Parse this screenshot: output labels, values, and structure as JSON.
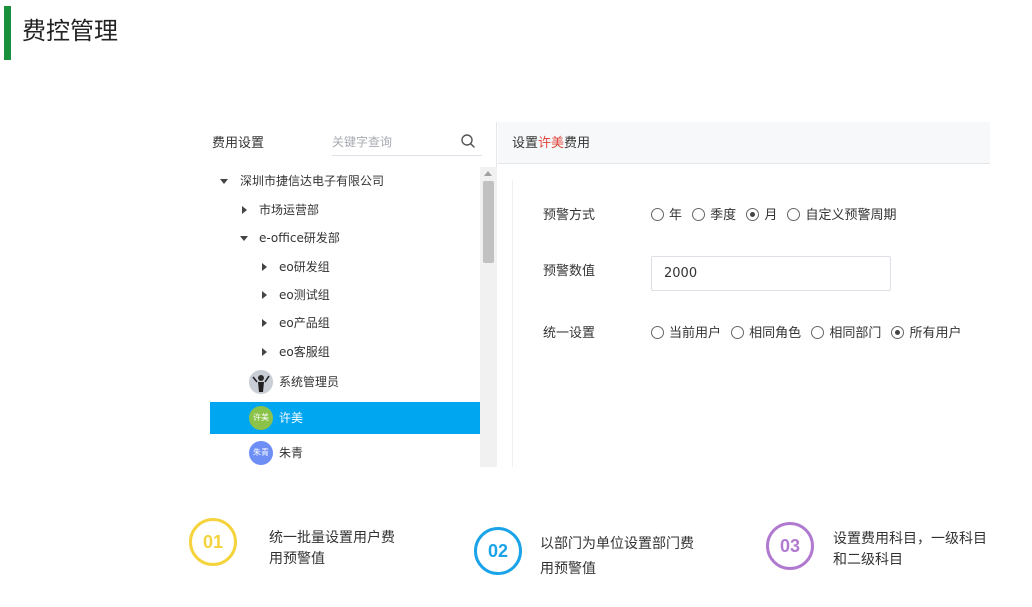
{
  "header": {
    "title": "费控管理",
    "accent_color": "#1a8f3c"
  },
  "left_panel": {
    "title": "费用设置",
    "search_placeholder": "关键字查询",
    "tree": [
      {
        "label": "深圳市捷信达电子有限公司",
        "expanded": true,
        "level": 0
      },
      {
        "label": "市场运营部",
        "expanded": false,
        "level": 1
      },
      {
        "label": "e-office研发部",
        "expanded": true,
        "level": 1
      },
      {
        "label": "eo研发组",
        "expanded": false,
        "level": 2
      },
      {
        "label": "eo测试组",
        "expanded": false,
        "level": 2
      },
      {
        "label": "eo产品组",
        "expanded": false,
        "level": 2
      },
      {
        "label": "eo客服组",
        "expanded": false,
        "level": 2
      }
    ],
    "users": [
      {
        "name": "系统管理员",
        "avatar_text": "",
        "avatar": "photo-icon",
        "selected": false
      },
      {
        "name": "许美",
        "avatar_text": "许美",
        "avatar": "green",
        "selected": true
      },
      {
        "name": "朱青",
        "avatar_text": "朱青",
        "avatar": "blue",
        "selected": false
      }
    ],
    "selected_color": "#00a6f0"
  },
  "right_panel": {
    "title_prefix": "设置",
    "title_name": "许美",
    "title_suffix": "费用",
    "highlight_color": "#e0463c",
    "warning_method": {
      "label": "预警方式",
      "options": [
        {
          "label": "年",
          "checked": false
        },
        {
          "label": "季度",
          "checked": false
        },
        {
          "label": "月",
          "checked": true
        },
        {
          "label": "自定义预警周期",
          "checked": false
        }
      ]
    },
    "warning_value": {
      "label": "预警数值",
      "value": "2000"
    },
    "unified_setting": {
      "label": "统一设置",
      "options": [
        {
          "label": "当前用户",
          "checked": false
        },
        {
          "label": "相同角色",
          "checked": false
        },
        {
          "label": "相同部门",
          "checked": false
        },
        {
          "label": "所有用户",
          "checked": true
        }
      ]
    }
  },
  "features": [
    {
      "number": "01",
      "line1": "统一批量设置用户费",
      "line2": "用预警值",
      "color": "#f5d33c"
    },
    {
      "number": "02",
      "line1": "以部门为单位设置部门费",
      "line2": "用预警值",
      "color": "#1aa3e8"
    },
    {
      "number": "03",
      "line1": "设置费用科目，一级科目",
      "line2": "和二级科目",
      "color": "#b17ad1"
    }
  ]
}
